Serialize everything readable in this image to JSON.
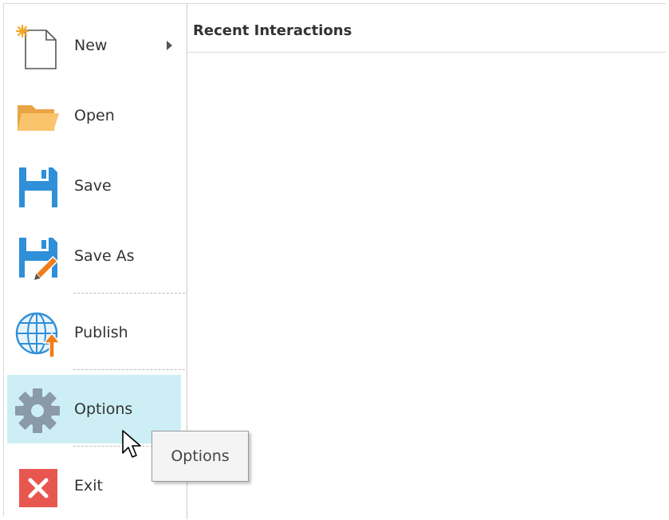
{
  "menu": {
    "items": [
      {
        "label": "New",
        "icon": "new-document-icon",
        "has_submenu": true
      },
      {
        "label": "Open",
        "icon": "folder-icon"
      },
      {
        "label": "Save",
        "icon": "floppy-disk-icon"
      },
      {
        "label": "Save As",
        "icon": "floppy-disk-pencil-icon"
      },
      {
        "label": "Publish",
        "icon": "globe-upload-icon"
      },
      {
        "label": "Options",
        "icon": "gear-icon",
        "state": "hover"
      },
      {
        "label": "Exit",
        "icon": "close-icon"
      }
    ]
  },
  "recent": {
    "title": "Recent Interactions"
  },
  "tooltip": {
    "text": "Options"
  },
  "colors": {
    "hover_bg": "#cdeef4",
    "save_blue": "#2f8fd8",
    "folder_orange": "#f7b659",
    "exit_red": "#e8574f",
    "publish_arrow": "#f07d1a",
    "gear_gray": "#8a9aa8"
  }
}
